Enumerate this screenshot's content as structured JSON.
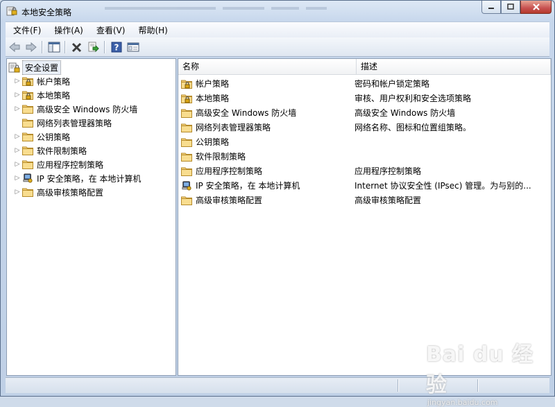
{
  "window": {
    "title": "本地安全策略"
  },
  "menu": [
    {
      "label": "文件(F)"
    },
    {
      "label": "操作(A)"
    },
    {
      "label": "查看(V)"
    },
    {
      "label": "帮助(H)"
    }
  ],
  "toolbar": [
    "back-icon",
    "forward-icon",
    "show-hide-tree-icon",
    "delete-icon",
    "export-list-icon",
    "help-icon",
    "properties-icon"
  ],
  "tree": {
    "root": "安全设置",
    "items": [
      {
        "label": "帐户策略",
        "icon": "locked-folder-icon",
        "expandable": true
      },
      {
        "label": "本地策略",
        "icon": "locked-folder-icon",
        "expandable": true
      },
      {
        "label": "高级安全 Windows 防火墙",
        "icon": "folder-icon",
        "expandable": true
      },
      {
        "label": "网络列表管理器策略",
        "icon": "folder-icon",
        "expandable": false
      },
      {
        "label": "公钥策略",
        "icon": "folder-icon",
        "expandable": true
      },
      {
        "label": "软件限制策略",
        "icon": "folder-icon",
        "expandable": true
      },
      {
        "label": "应用程序控制策略",
        "icon": "folder-icon",
        "expandable": true
      },
      {
        "label": "IP 安全策略，在 本地计算机",
        "icon": "ip-security-icon",
        "expandable": true
      },
      {
        "label": "高级审核策略配置",
        "icon": "folder-icon",
        "expandable": true
      }
    ]
  },
  "list": {
    "headers": {
      "name": "名称",
      "description": "描述"
    },
    "rows": [
      {
        "name": "帐户策略",
        "icon": "locked-folder-icon",
        "description": "密码和帐户锁定策略"
      },
      {
        "name": "本地策略",
        "icon": "locked-folder-icon",
        "description": "审核、用户权利和安全选项策略"
      },
      {
        "name": "高级安全 Windows 防火墙",
        "icon": "folder-icon",
        "description": "高级安全 Windows 防火墙"
      },
      {
        "name": "网络列表管理器策略",
        "icon": "folder-icon",
        "description": "网络名称、图标和位置组策略。"
      },
      {
        "name": "公钥策略",
        "icon": "folder-icon",
        "description": ""
      },
      {
        "name": "软件限制策略",
        "icon": "folder-icon",
        "description": ""
      },
      {
        "name": "应用程序控制策略",
        "icon": "folder-icon",
        "description": "应用程序控制策略"
      },
      {
        "name": "IP 安全策略，在 本地计算机",
        "icon": "ip-security-icon",
        "description": "Internet 协议安全性 (IPsec) 管理。为与别的..."
      },
      {
        "name": "高级审核策略配置",
        "icon": "folder-icon",
        "description": "高级审核策略配置"
      }
    ]
  },
  "watermark": {
    "brand": "Bai du 经验",
    "url": "jingyan.baidu.com"
  }
}
